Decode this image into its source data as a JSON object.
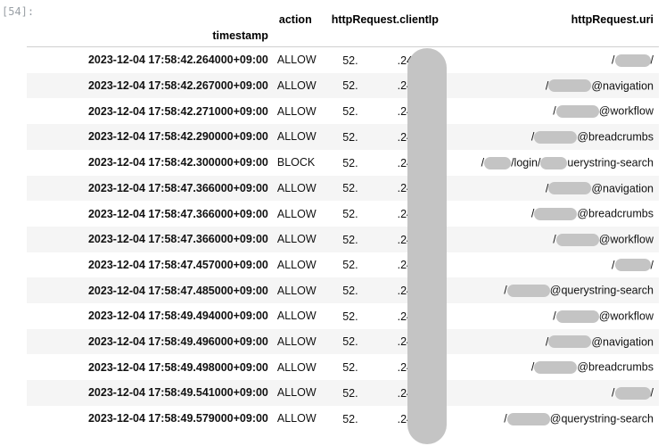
{
  "cell_prompt": "[54]:",
  "columns": {
    "timestamp_label": "timestamp",
    "action_label": "action",
    "clientip_label": "httpRequest.clientIp",
    "uri_label": "httpRequest.uri"
  },
  "ip_parts": {
    "prefix": "52.",
    "suffix": ".247"
  },
  "rows": [
    {
      "timestamp": "2023-12-04 17:58:42.264000+09:00",
      "action": "ALLOW",
      "uri_segments": [
        {
          "t": "/"
        },
        {
          "blur": "w2"
        },
        {
          "t": "/"
        }
      ]
    },
    {
      "timestamp": "2023-12-04 17:58:42.267000+09:00",
      "action": "ALLOW",
      "uri_segments": [
        {
          "t": "/"
        },
        {
          "blur": "w3"
        },
        {
          "t": "@navigation"
        }
      ]
    },
    {
      "timestamp": "2023-12-04 17:58:42.271000+09:00",
      "action": "ALLOW",
      "uri_segments": [
        {
          "t": "/"
        },
        {
          "blur": "w3"
        },
        {
          "t": "@workflow"
        }
      ]
    },
    {
      "timestamp": "2023-12-04 17:58:42.290000+09:00",
      "action": "ALLOW",
      "uri_segments": [
        {
          "t": "/"
        },
        {
          "blur": "w3"
        },
        {
          "t": "@breadcrumbs"
        }
      ]
    },
    {
      "timestamp": "2023-12-04 17:58:42.300000+09:00",
      "action": "BLOCK",
      "uri_segments": [
        {
          "t": "/"
        },
        {
          "blur": "w1"
        },
        {
          "t": "/login/"
        },
        {
          "blur": "w1"
        },
        {
          "t": "uerystring-search"
        }
      ]
    },
    {
      "timestamp": "2023-12-04 17:58:47.366000+09:00",
      "action": "ALLOW",
      "uri_segments": [
        {
          "t": "/"
        },
        {
          "blur": "w3"
        },
        {
          "t": "@navigation"
        }
      ]
    },
    {
      "timestamp": "2023-12-04 17:58:47.366000+09:00",
      "action": "ALLOW",
      "uri_segments": [
        {
          "t": "/"
        },
        {
          "blur": "w3"
        },
        {
          "t": "@breadcrumbs"
        }
      ]
    },
    {
      "timestamp": "2023-12-04 17:58:47.366000+09:00",
      "action": "ALLOW",
      "uri_segments": [
        {
          "t": "/"
        },
        {
          "blur": "w3"
        },
        {
          "t": "@workflow"
        }
      ]
    },
    {
      "timestamp": "2023-12-04 17:58:47.457000+09:00",
      "action": "ALLOW",
      "uri_segments": [
        {
          "t": "/"
        },
        {
          "blur": "w2"
        },
        {
          "t": "/"
        }
      ]
    },
    {
      "timestamp": "2023-12-04 17:58:47.485000+09:00",
      "action": "ALLOW",
      "uri_segments": [
        {
          "t": "/"
        },
        {
          "blur": "w3"
        },
        {
          "t": "@querystring-search"
        }
      ]
    },
    {
      "timestamp": "2023-12-04 17:58:49.494000+09:00",
      "action": "ALLOW",
      "uri_segments": [
        {
          "t": "/"
        },
        {
          "blur": "w3"
        },
        {
          "t": "@workflow"
        }
      ]
    },
    {
      "timestamp": "2023-12-04 17:58:49.496000+09:00",
      "action": "ALLOW",
      "uri_segments": [
        {
          "t": "/"
        },
        {
          "blur": "w3"
        },
        {
          "t": "@navigation"
        }
      ]
    },
    {
      "timestamp": "2023-12-04 17:58:49.498000+09:00",
      "action": "ALLOW",
      "uri_segments": [
        {
          "t": "/"
        },
        {
          "blur": "w3"
        },
        {
          "t": "@breadcrumbs"
        }
      ]
    },
    {
      "timestamp": "2023-12-04 17:58:49.541000+09:00",
      "action": "ALLOW",
      "uri_segments": [
        {
          "t": "/"
        },
        {
          "blur": "w2"
        },
        {
          "t": "/"
        }
      ]
    },
    {
      "timestamp": "2023-12-04 17:58:49.579000+09:00",
      "action": "ALLOW",
      "uri_segments": [
        {
          "t": "/"
        },
        {
          "blur": "w3"
        },
        {
          "t": "@querystring-search"
        }
      ]
    }
  ]
}
